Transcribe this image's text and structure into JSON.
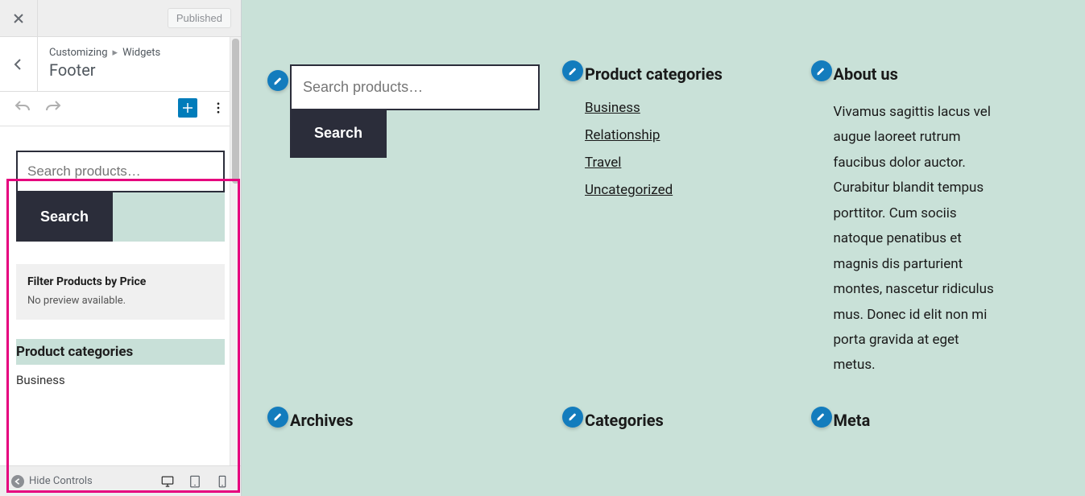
{
  "panel": {
    "publish_label": "Published",
    "breadcrumb_root": "Customizing",
    "breadcrumb_parent": "Widgets",
    "section_title": "Footer",
    "editor": {
      "search_placeholder": "Search products…",
      "search_button": "Search",
      "filter_title": "Filter Products by Price",
      "filter_subtitle": "No preview available.",
      "pcat_title": "Product categories",
      "pcat_first": "Business"
    },
    "hide_controls_label": "Hide Controls"
  },
  "preview": {
    "search": {
      "placeholder": "Search products…",
      "button": "Search"
    },
    "pcat": {
      "title": "Product categories",
      "items": [
        "Business",
        "Relationship",
        "Travel",
        "Uncategorized"
      ]
    },
    "about": {
      "title": "About us",
      "body": "Vivamus sagittis lacus vel augue laoreet rutrum faucibus dolor auctor. Curabitur blandit tempus porttitor. Cum sociis natoque penatibus et magnis dis parturient montes, nascetur ridiculus mus. Donec id elit non mi porta gravida at eget metus."
    },
    "row2": {
      "archives": "Archives",
      "categories": "Categories",
      "meta": "Meta"
    }
  }
}
